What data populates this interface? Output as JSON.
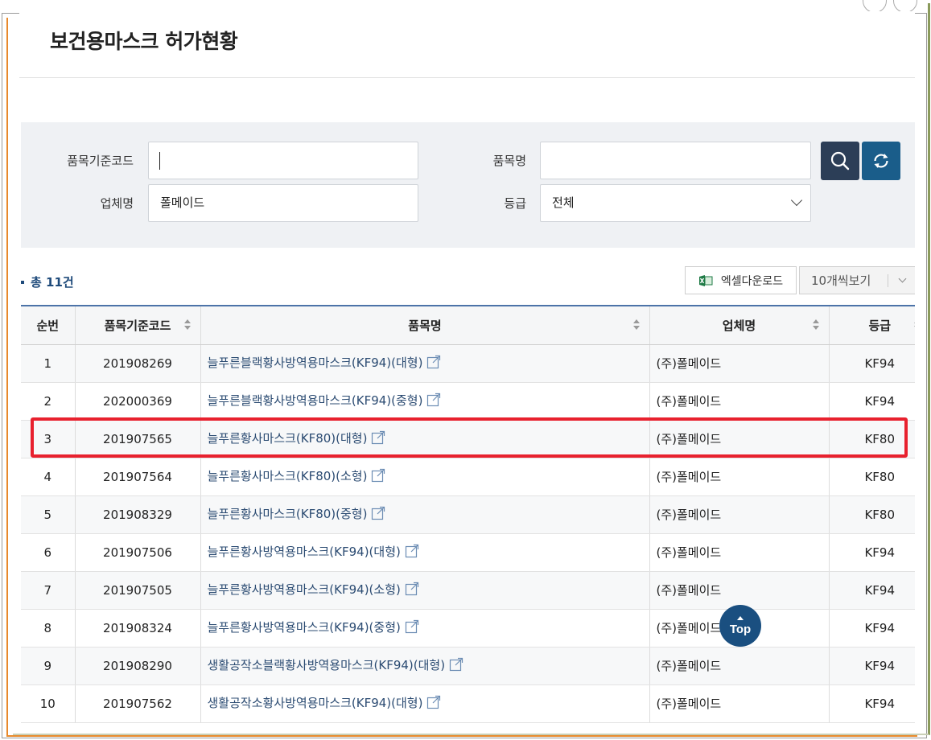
{
  "title": "보건용마스크 허가현황",
  "search": {
    "code_label": "품목기준코드",
    "code_value": "",
    "name_label": "품목명",
    "name_value": "",
    "company_label": "업체명",
    "company_value": "폴메이드",
    "grade_label": "등급",
    "grade_value": "전체",
    "search_icon": "search-icon",
    "reset_icon": "refresh-icon"
  },
  "list": {
    "total_label": "총 11건",
    "excel_label": "엑셀다운로드",
    "per_page_label": "10개씩보기"
  },
  "table": {
    "headers": [
      "순번",
      "품목기준코드",
      "품목명",
      "업체명",
      "등급"
    ],
    "rows": [
      {
        "no": "1",
        "code": "201908269",
        "name": "늘푸른블랙황사방역용마스크(KF94)(대형)",
        "company": "(주)폴메이드",
        "grade": "KF94"
      },
      {
        "no": "2",
        "code": "202000369",
        "name": "늘푸른블랙황사방역용마스크(KF94)(중형)",
        "company": "(주)폴메이드",
        "grade": "KF94"
      },
      {
        "no": "3",
        "code": "201907565",
        "name": "늘푸른황사마스크(KF80)(대형)",
        "company": "(주)폴메이드",
        "grade": "KF80"
      },
      {
        "no": "4",
        "code": "201907564",
        "name": "늘푸른황사마스크(KF80)(소형)",
        "company": "(주)폴메이드",
        "grade": "KF80"
      },
      {
        "no": "5",
        "code": "201908329",
        "name": "늘푸른황사마스크(KF80)(중형)",
        "company": "(주)폴메이드",
        "grade": "KF80"
      },
      {
        "no": "6",
        "code": "201907506",
        "name": "늘푸른황사방역용마스크(KF94)(대형)",
        "company": "(주)폴메이드",
        "grade": "KF94"
      },
      {
        "no": "7",
        "code": "201907505",
        "name": "늘푸른황사방역용마스크(KF94)(소형)",
        "company": "(주)폴메이드",
        "grade": "KF94"
      },
      {
        "no": "8",
        "code": "201908324",
        "name": "늘푸른황사방역용마스크(KF94)(중형)",
        "company": "(주)폴메이드",
        "grade": "KF94"
      },
      {
        "no": "9",
        "code": "201908290",
        "name": "생활공작소블랙황사방역용마스크(KF94)(대형)",
        "company": "(주)폴메이드",
        "grade": "KF94"
      },
      {
        "no": "10",
        "code": "201907562",
        "name": "생활공작소황사방역용마스크(KF94)(대형)",
        "company": "(주)폴메이드",
        "grade": "KF94"
      }
    ]
  },
  "top_button_label": "Top",
  "colors": {
    "accent": "#1a4f80",
    "highlight": "#e8212e",
    "header_line": "#4c73a8"
  }
}
